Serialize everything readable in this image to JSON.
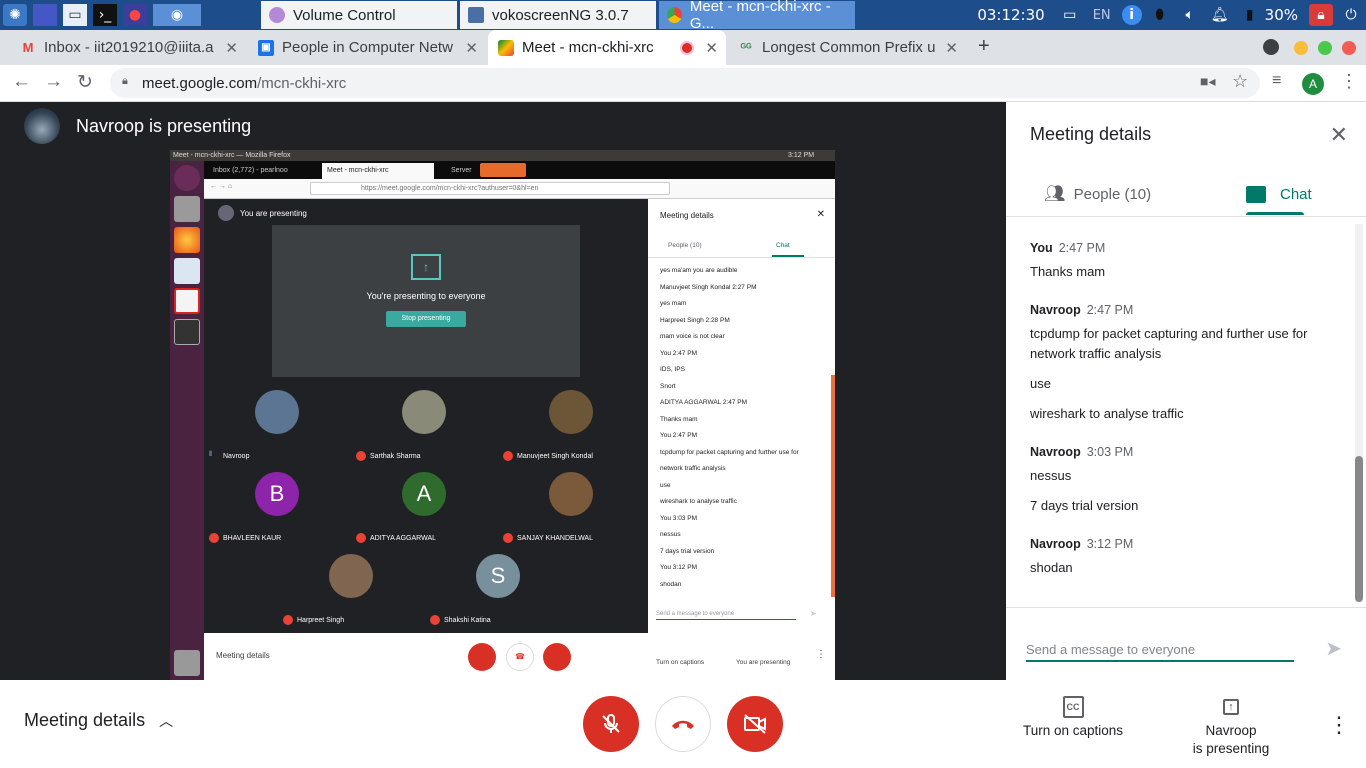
{
  "taskbar": {
    "windows": [
      "Volume Control",
      "vokoscreenNG 3.0.7",
      "Meet - mcn-ckhi-xrc - G..."
    ],
    "clock": "03:12:30",
    "lang": "EN",
    "battery": "30%"
  },
  "browser": {
    "tabs": [
      {
        "label": "Inbox - iit2019210@iiita.a",
        "icon": "gmail-icon"
      },
      {
        "label": "People in Computer Netw",
        "icon": "classroom-icon"
      },
      {
        "label": "Meet - mcn-ckhi-xrc",
        "icon": "meet-icon"
      },
      {
        "label": "Longest Common Prefix u",
        "icon": "gfg-icon"
      }
    ],
    "url_host": "meet.google.com",
    "url_path": "/mcn-ckhi-xrc",
    "profile_initial": "A"
  },
  "stage": {
    "presenter_text": "Navroop is presenting"
  },
  "shared_screen": {
    "window_title": "Meet - mcn-ckhi-xrc — Mozilla Firefox",
    "clock": "3:12 PM",
    "tabs": [
      "Inbox (2,772) - pearlnoo",
      "Meet - mcn-ckhi-xrc",
      "Server"
    ],
    "url": "https://meet.google.com/mcn-ckhi-xrc?authuser=0&hl=en",
    "you_presenting": "You are presenting",
    "presenting_to_all": "You're presenting to everyone",
    "stop_presenting": "Stop presenting",
    "participants": [
      {
        "name": "Navroop",
        "initial": ""
      },
      {
        "name": "Sarthak Sharma",
        "initial": ""
      },
      {
        "name": "Manuvjeet Singh Kondal",
        "initial": ""
      },
      {
        "name": "BHAVLEEN KAUR",
        "initial": "B"
      },
      {
        "name": "ADITYA AGGARWAL",
        "initial": "A"
      },
      {
        "name": "SANJAY KHANDELWAL",
        "initial": ""
      },
      {
        "name": "Harpreet Singh",
        "initial": ""
      },
      {
        "name": "Shakshi Katina",
        "initial": "S"
      }
    ],
    "side_title": "Meeting details",
    "side_people": "People (10)",
    "side_chat": "Chat",
    "chat_lines": [
      "yes ma'am you are audible",
      "Manuvjeet Singh Kondal  2:27 PM",
      "yes mam",
      "Harpreet Singh  2:28 PM",
      "mam voice is not clear",
      "You  2:47 PM",
      "IDS, IPS",
      "Snort",
      "ADITYA AGGARWAL  2:47 PM",
      "Thanks mam",
      "You  2:47 PM",
      "tcpdump for packet capturing and further use for",
      "network traffic analysis",
      "use",
      "wireshark to analyse traffic",
      "You  3:03 PM",
      "nessus",
      "7 days trial version",
      "You  3:12 PM",
      "shodan"
    ],
    "compose_placeholder": "Send a message to everyone",
    "meeting_details": "Meeting details",
    "captions": "Turn on captions",
    "you_are_presenting": "You are presenting"
  },
  "panel": {
    "title": "Meeting details",
    "people_tab": "People (10)",
    "chat_tab": "Chat",
    "messages": [
      {
        "sender": "You",
        "time": "2:47 PM",
        "texts": [
          "Thanks mam"
        ]
      },
      {
        "sender": "Navroop",
        "time": "2:47 PM",
        "texts": [
          "tcpdump for packet capturing and further use for network traffic analysis",
          "use",
          "wireshark to analyse traffic"
        ]
      },
      {
        "sender": "Navroop",
        "time": "3:03 PM",
        "texts": [
          "nessus",
          "7 days trial version"
        ]
      },
      {
        "sender": "Navroop",
        "time": "3:12 PM",
        "texts": [
          "shodan"
        ]
      }
    ],
    "compose_placeholder": "Send a message to everyone"
  },
  "bottom": {
    "meeting_details": "Meeting details",
    "captions": "Turn on captions",
    "presenting_line1": "Navroop",
    "presenting_line2": "is presenting"
  },
  "colors": {
    "accent": "#00796b",
    "danger": "#d93025",
    "taskbar": "#1e4d8c"
  }
}
